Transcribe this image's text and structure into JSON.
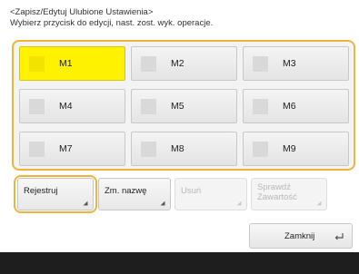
{
  "header": {
    "line1": "<Zapisz/Edytuj Ulubione Ustawienia>",
    "line2": "Wybierz przycisk do edycji, nast. zost. wyk. operacje."
  },
  "memory_buttons": [
    {
      "label": "M1",
      "selected": true
    },
    {
      "label": "M2",
      "selected": false
    },
    {
      "label": "M3",
      "selected": false
    },
    {
      "label": "M4",
      "selected": false
    },
    {
      "label": "M5",
      "selected": false
    },
    {
      "label": "M6",
      "selected": false
    },
    {
      "label": "M7",
      "selected": false
    },
    {
      "label": "M8",
      "selected": false
    },
    {
      "label": "M9",
      "selected": false
    }
  ],
  "actions": {
    "register": "Rejestruj",
    "rename": "Zm. nazwę",
    "delete": "Usuń",
    "check_line1": "Sprawdź",
    "check_line2": "Zawartość"
  },
  "close_label": "Zamknij",
  "colors": {
    "highlight_border": "#f0b43c",
    "selected_fill": "#fff200",
    "bottom_bar": "#1e1e1e"
  }
}
